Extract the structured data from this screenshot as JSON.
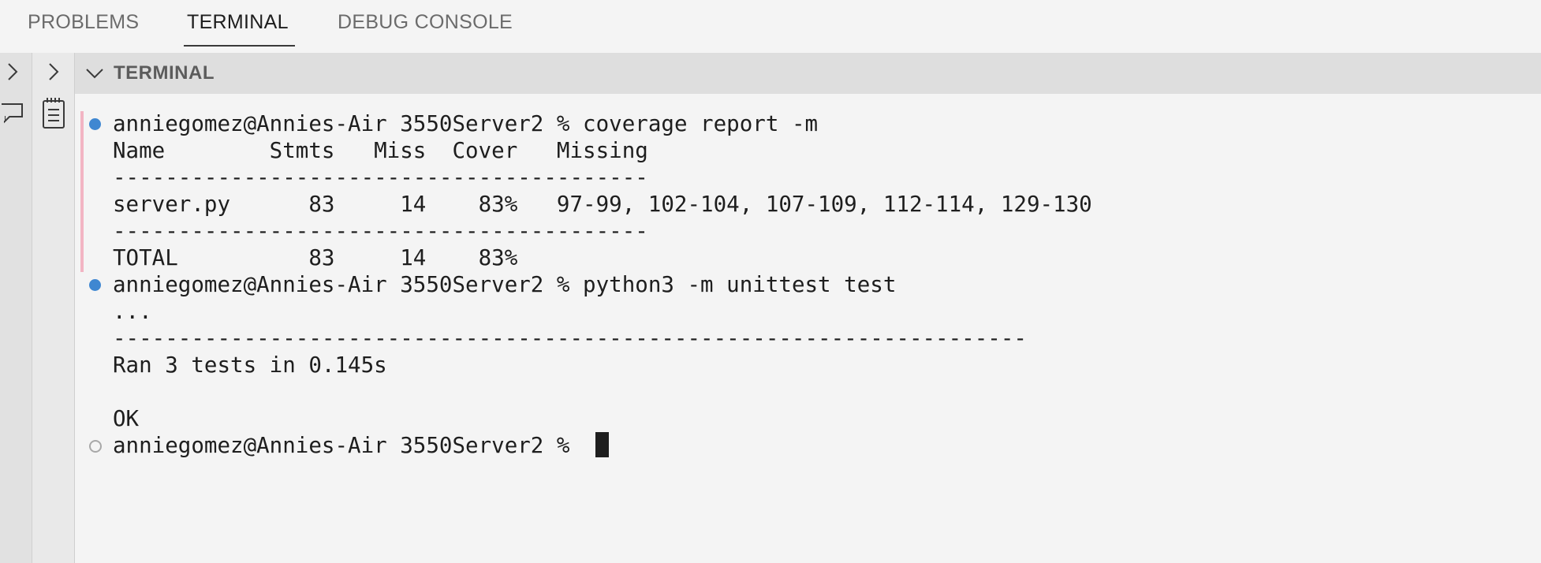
{
  "tabs": [
    {
      "label": "PROBLEMS",
      "active": false
    },
    {
      "label": "TERMINAL",
      "active": true
    },
    {
      "label": "DEBUG CONSOLE",
      "active": false
    }
  ],
  "panel": {
    "title": "TERMINAL"
  },
  "icons": {
    "left_chevron": "chevron-right-icon",
    "chat": "chat-icon",
    "notepad": "notepad-icon",
    "collapse": "chevron-down-icon"
  },
  "colors": {
    "prompt_dot_success": "#3f87d1",
    "prompt_dot_idle": "#a8a8a8",
    "command_marker": "#f2b4c3"
  },
  "terminal": {
    "prompt": "anniegomez@Annies-Air 3550Server2 %",
    "commands": [
      {
        "input": "coverage report -m",
        "output": [
          "Name        Stmts   Miss  Cover   Missing",
          "-----------------------------------------",
          "server.py      83     14    83%   97-99, 102-104, 107-109, 112-114, 129-130",
          "-----------------------------------------",
          "TOTAL          83     14    83%"
        ]
      },
      {
        "input": "python3 -m unittest test",
        "output": [
          "...",
          "----------------------------------------------------------------------",
          "Ran 3 tests in 0.145s",
          "",
          "OK"
        ]
      }
    ],
    "current_prompt": "anniegomez@Annies-Air 3550Server2 %"
  }
}
